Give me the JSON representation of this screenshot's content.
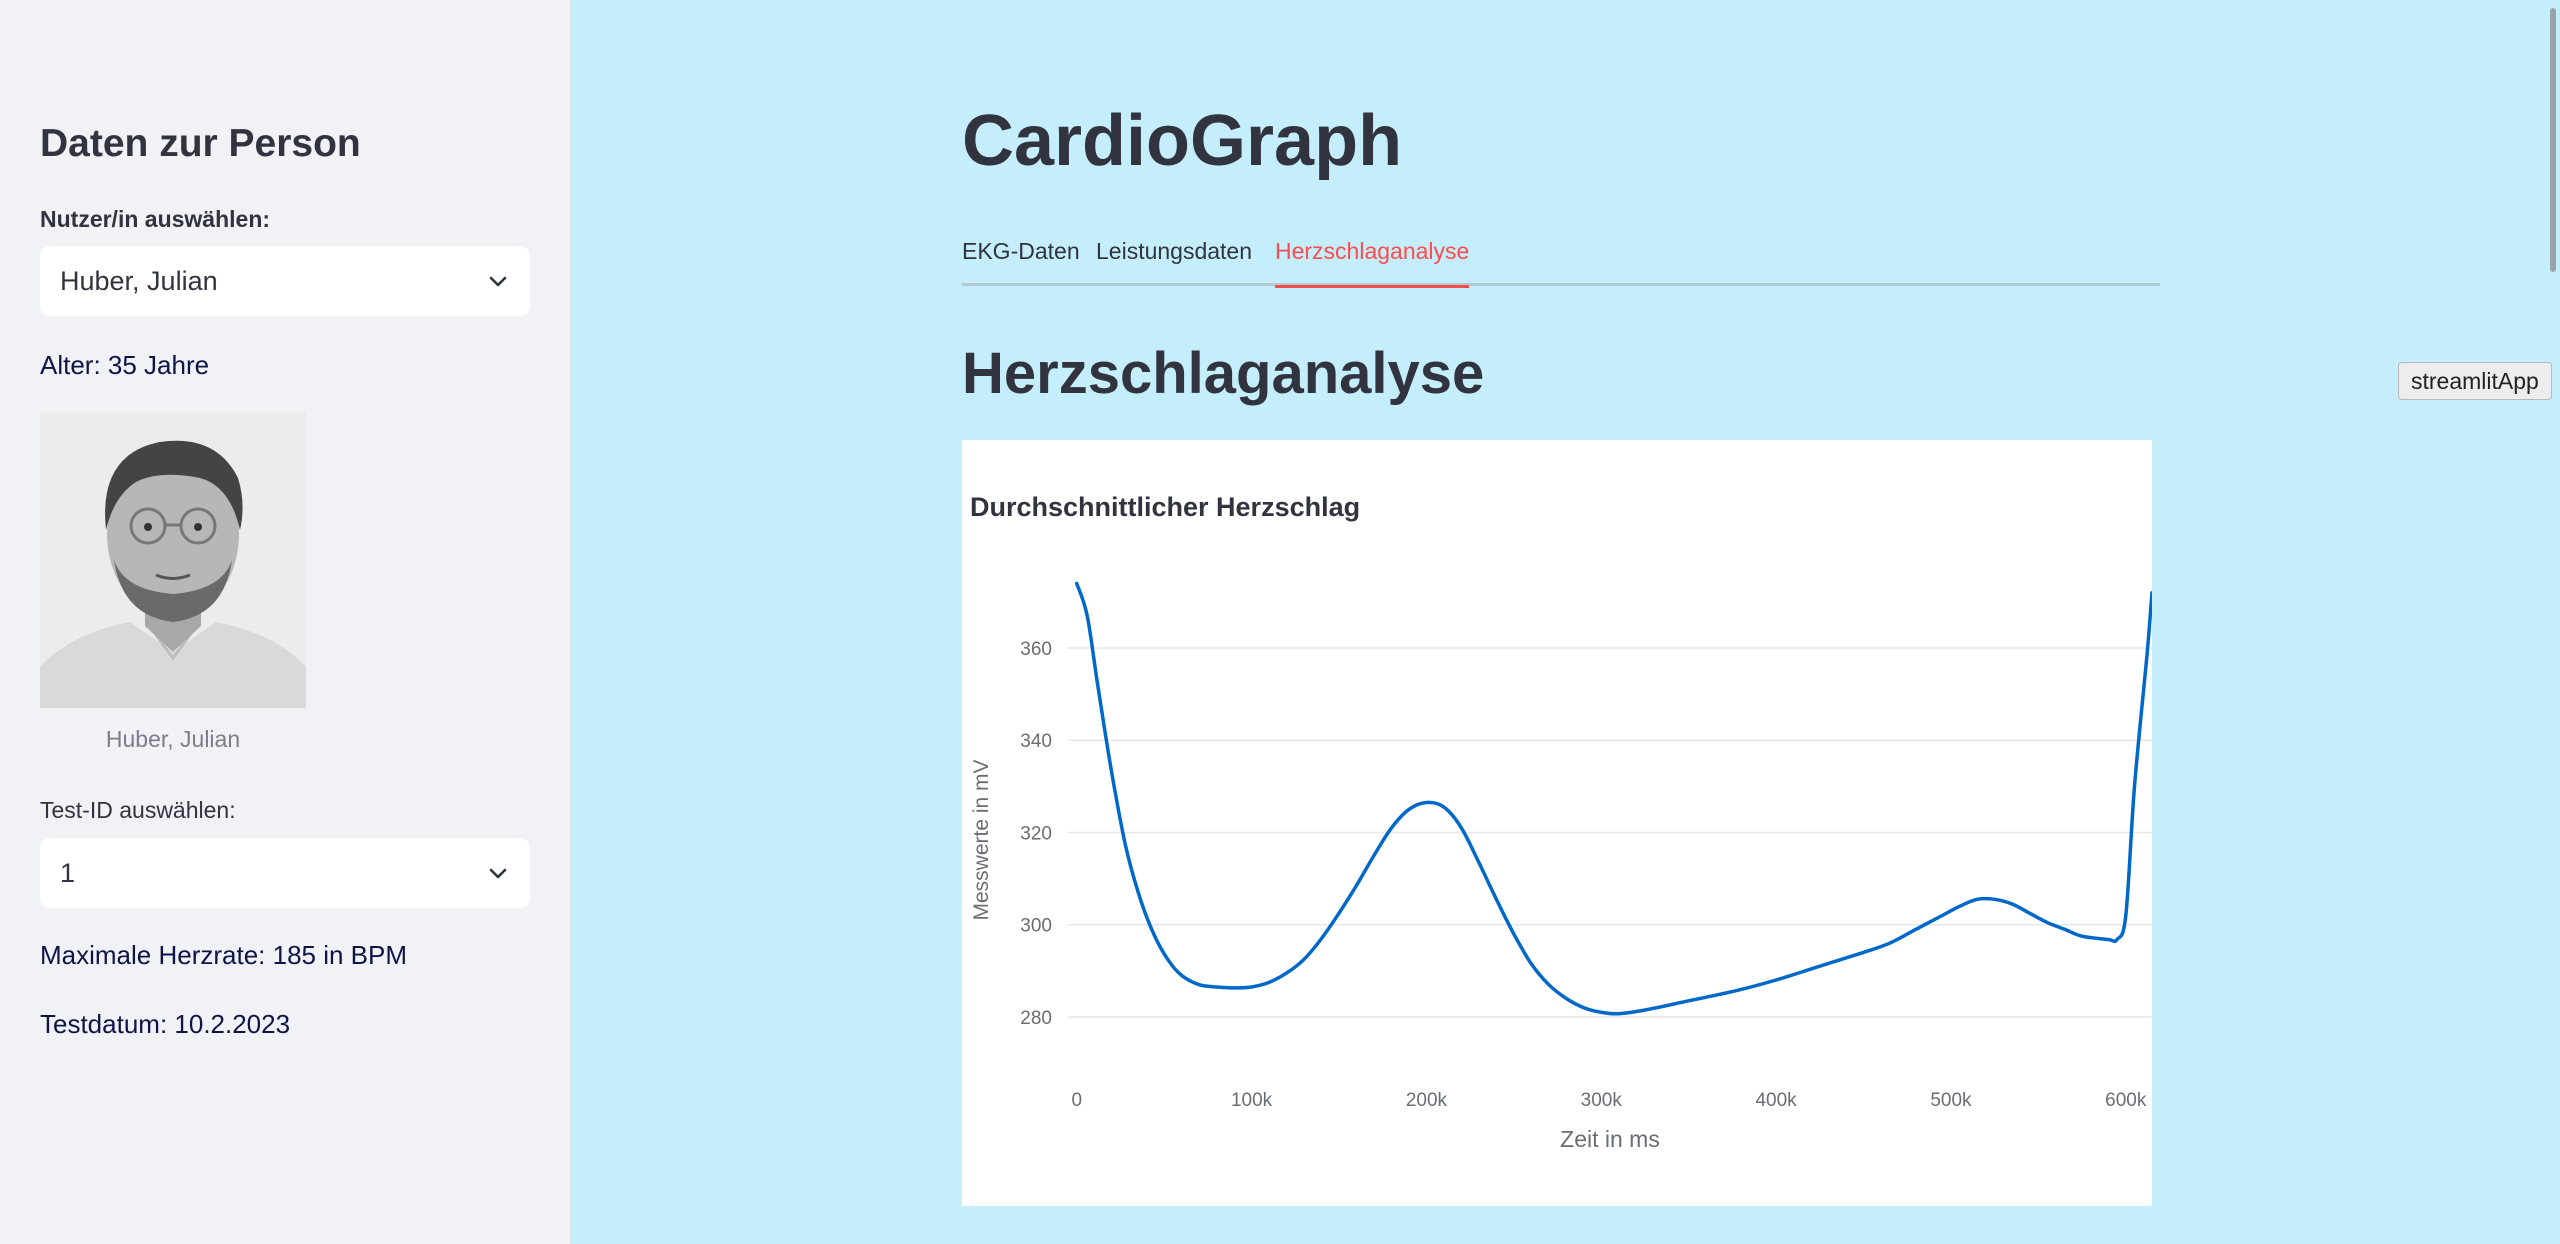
{
  "sidebar": {
    "title": "Daten zur Person",
    "user_label": "Nutzer/in auswählen:",
    "user_value": "Huber, Julian",
    "age_text": "Alter: 35 Jahre",
    "photo_caption": "Huber, Julian",
    "test_label": "Test-ID auswählen:",
    "test_value": "1",
    "max_hr_text": "Maximale Herzrate: 185 in BPM",
    "test_date_text": "Testdatum: 10.2.2023"
  },
  "main": {
    "title": "CardioGraph",
    "tabs": [
      {
        "label": "EKG-Daten",
        "active": false
      },
      {
        "label": "Leistungsdaten",
        "active": false
      },
      {
        "label": "Herzschlaganalyse",
        "active": true
      }
    ],
    "section_title": "Herzschlaganalyse"
  },
  "tooltip": "streamlitApp",
  "colors": {
    "accent": "#ff4b4b",
    "main_bg": "#c4eefb",
    "sidebar_bg": "#f0f2f6",
    "line": "#0068c9"
  },
  "chart_data": {
    "type": "line",
    "title": "Durchschnittlicher Herzschlag",
    "xlabel": "Zeit in ms",
    "ylabel": "Messwerte in mV",
    "xlim": [
      -5000,
      615000
    ],
    "ylim": [
      275,
      378
    ],
    "xticks": [
      0,
      100000,
      200000,
      300000,
      400000,
      500000,
      600000
    ],
    "xtick_labels": [
      "0",
      "100k",
      "200k",
      "300k",
      "400k",
      "500k",
      "600k"
    ],
    "yticks": [
      280,
      300,
      320,
      340,
      360
    ],
    "grid": true,
    "legend": "none",
    "series": [
      {
        "x": [
          0,
          6000,
          12000,
          20000,
          28000,
          36000,
          44000,
          52000,
          60000,
          70000,
          80000,
          90000,
          100000,
          110000,
          120000,
          130000,
          140000,
          150000,
          160000,
          170000,
          180000,
          190000,
          200000,
          210000,
          220000,
          230000,
          240000,
          250000,
          260000,
          270000,
          280000,
          290000,
          300000,
          310000,
          325000,
          350000,
          375000,
          400000,
          425000,
          450000,
          465000,
          480000,
          495000,
          505000,
          515000,
          525000,
          535000,
          545000,
          555000,
          565000,
          575000,
          590000,
          595000,
          600000,
          605000,
          612000,
          615000
        ],
        "y": [
          374,
          367,
          352,
          333,
          317,
          306,
          298,
          292.5,
          289,
          287,
          286.5,
          286.3,
          286.5,
          287.5,
          289.5,
          292.5,
          297,
          302.5,
          308.5,
          315,
          321,
          325,
          326.5,
          325.5,
          321,
          313.5,
          305.5,
          298,
          291.5,
          287,
          284,
          282,
          281,
          280.7,
          281.5,
          283.5,
          285.5,
          288,
          291,
          294,
          296,
          299,
          302,
          304,
          305.5,
          305.5,
          304.5,
          302.5,
          300.5,
          299,
          297.5,
          296.8,
          296.8,
          302,
          330,
          358,
          372
        ]
      }
    ]
  }
}
